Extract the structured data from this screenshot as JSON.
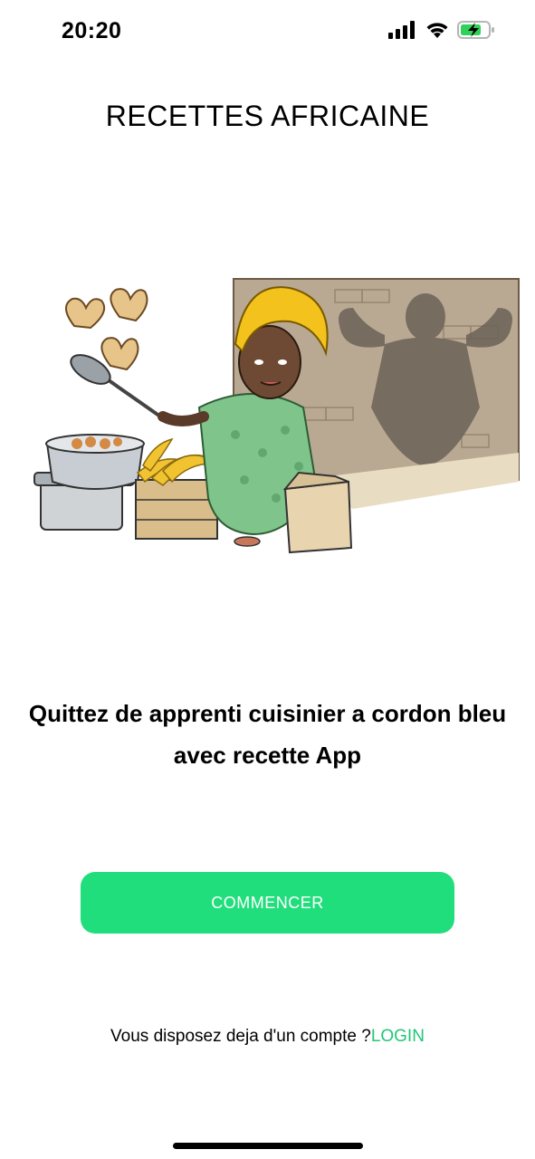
{
  "status_bar": {
    "time": "20:20",
    "icons": [
      "cellular-signal-icon",
      "wifi-icon",
      "battery-charging-icon"
    ],
    "battery_color": "#30d158"
  },
  "header": {
    "title": "RECETTES AFRICAINE"
  },
  "hero": {
    "icon": "cooking-woman-illustration"
  },
  "tagline": {
    "text": "Quittez de apprenti cuisinier a cordon bleu avec recette App"
  },
  "cta": {
    "label": "COMMENCER",
    "color": "#21de7c"
  },
  "login": {
    "prompt": "Vous disposez deja d'un compte ?",
    "link_label": "LOGIN",
    "link_color": "#21c776"
  }
}
